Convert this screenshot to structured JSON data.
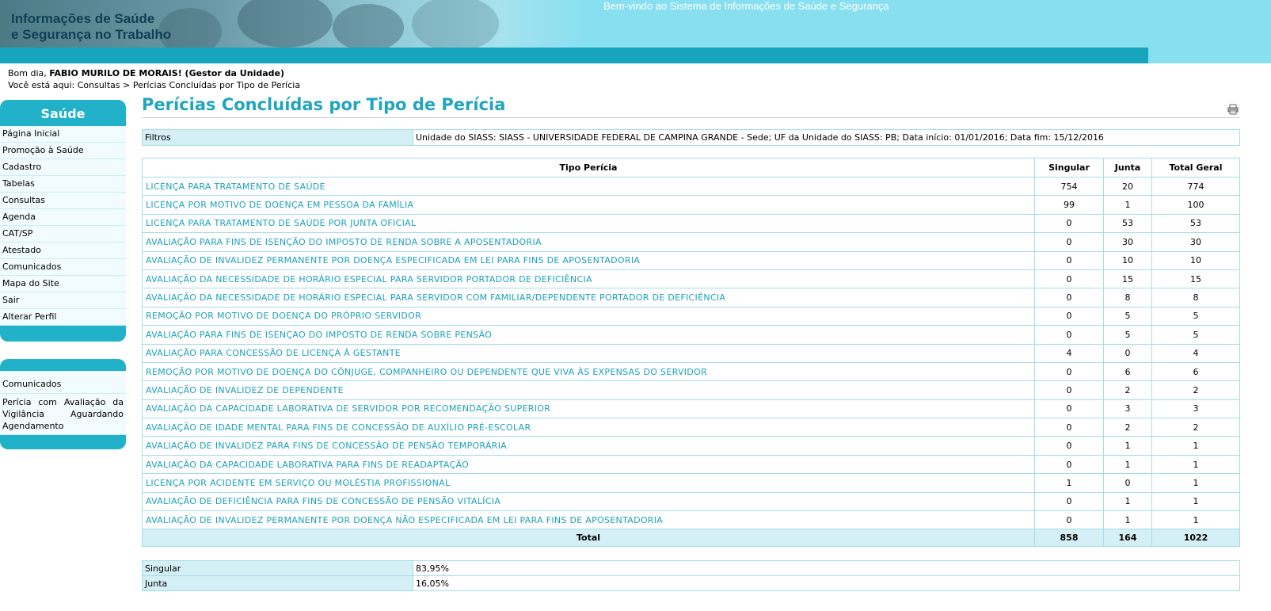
{
  "header": {
    "title_line1": "Informações de Saúde",
    "title_line2": "e Segurança no Trabalho",
    "welcome": "Bem-vindo ao Sistema de Informações de Saúde e Segurança"
  },
  "user": {
    "greeting_prefix": "Bom dia, ",
    "name": "FABIO MURILO DE MORAIS! (Gestor da Unidade)"
  },
  "breadcrumb": {
    "prefix": "Você está aqui: ",
    "parent": "Consultas",
    "separator": " > ",
    "current": "Perícias Concluídas por Tipo de Perícia"
  },
  "sidebar": {
    "title": "Saúde",
    "items": [
      {
        "label": "Página Inicial"
      },
      {
        "label": "Promoção à Saúde"
      },
      {
        "label": "Cadastro"
      },
      {
        "label": "Tabelas"
      },
      {
        "label": "Consultas"
      },
      {
        "label": "Agenda"
      },
      {
        "label": "CAT/SP"
      },
      {
        "label": "Atestado"
      },
      {
        "label": "Comunicados"
      },
      {
        "label": "Mapa do Site"
      },
      {
        "label": "Sair"
      },
      {
        "label": "Alterar Perfil"
      }
    ]
  },
  "sidebar2": {
    "items": [
      {
        "label": "Comunicados"
      },
      {
        "label": "Perícia com Avaliação da Vigilância Aguardando Agendamento"
      }
    ]
  },
  "page": {
    "title": "Perícias Concluídas por Tipo de Perícia",
    "print_icon": "printer-icon"
  },
  "filters": {
    "label": "Filtros",
    "value": "Unidade do SIASS: SIASS - UNIVERSIDADE FEDERAL DE CAMPINA GRANDE - Sede; UF da Unidade do SIASS: PB; Data início: 01/01/2016; Data fim: 15/12/2016"
  },
  "table": {
    "headers": {
      "tipo": "Tipo Perícia",
      "singular": "Singular",
      "junta": "Junta",
      "total": "Total Geral"
    },
    "rows": [
      {
        "tipo": "LICENÇA PARA TRATAMENTO DE SAÚDE",
        "singular": "754",
        "junta": "20",
        "total": "774"
      },
      {
        "tipo": "LICENÇA POR MOTIVO DE DOENÇA EM PESSOA DA FAMÍLIA",
        "singular": "99",
        "junta": "1",
        "total": "100"
      },
      {
        "tipo": "LICENÇA PARA TRATAMENTO DE SAÚDE POR JUNTA OFICIAL",
        "singular": "0",
        "junta": "53",
        "total": "53"
      },
      {
        "tipo": "AVALIAÇÃO PARA FINS DE ISENÇÃO DO IMPOSTO DE RENDA SOBRE A APOSENTADORIA",
        "singular": "0",
        "junta": "30",
        "total": "30"
      },
      {
        "tipo": "AVALIAÇÃO DE INVALIDEZ PERMANENTE POR DOENÇA ESPECIFICADA EM LEI PARA FINS DE APOSENTADORIA",
        "singular": "0",
        "junta": "10",
        "total": "10"
      },
      {
        "tipo": "AVALIAÇÃO DA NECESSIDADE DE HORÁRIO ESPECIAL PARA SERVIDOR PORTADOR DE DEFICIÊNCIA",
        "singular": "0",
        "junta": "15",
        "total": "15"
      },
      {
        "tipo": "AVALIAÇÃO DA NECESSIDADE DE HORÁRIO ESPECIAL PARA SERVIDOR COM FAMILIAR/DEPENDENTE PORTADOR DE DEFICIÊNCIA",
        "singular": "0",
        "junta": "8",
        "total": "8"
      },
      {
        "tipo": "REMOÇÃO POR MOTIVO DE DOENÇA DO PRÓPRIO SERVIDOR",
        "singular": "0",
        "junta": "5",
        "total": "5"
      },
      {
        "tipo": "AVALIAÇÃO PARA FINS DE ISENÇAO DO IMPOSTO DE RENDA SOBRE PENSÃO",
        "singular": "0",
        "junta": "5",
        "total": "5"
      },
      {
        "tipo": "AVALIAÇÃO PARA CONCESSÃO DE LICENÇA À GESTANTE",
        "singular": "4",
        "junta": "0",
        "total": "4"
      },
      {
        "tipo": "REMOÇÃO POR MOTIVO DE DOENÇA DO CÔNJUGE, COMPANHEIRO OU DEPENDENTE QUE VIVA ÀS EXPENSAS DO SERVIDOR",
        "singular": "0",
        "junta": "6",
        "total": "6"
      },
      {
        "tipo": "AVALIAÇÃO DE INVALIDEZ DE DEPENDENTE",
        "singular": "0",
        "junta": "2",
        "total": "2"
      },
      {
        "tipo": "AVALIAÇÃO DA CAPACIDADE LABORATIVA DE SERVIDOR POR RECOMENDAÇÃO SUPERIOR",
        "singular": "0",
        "junta": "3",
        "total": "3"
      },
      {
        "tipo": "AVALIAÇÃO DE IDADE MENTAL PARA FINS DE CONCESSÃO DE AUXÍLIO PRÉ-ESCOLAR",
        "singular": "0",
        "junta": "2",
        "total": "2"
      },
      {
        "tipo": "AVALIAÇÃO DE INVALIDEZ PARA FINS DE CONCESSÃO DE PENSÃO TEMPORÁRIA",
        "singular": "0",
        "junta": "1",
        "total": "1"
      },
      {
        "tipo": "AVALIAÇÃO DA CAPACIDADE LABORATIVA PARA FINS DE READAPTAÇÃO",
        "singular": "0",
        "junta": "1",
        "total": "1"
      },
      {
        "tipo": "LICENÇA POR ACIDENTE EM SERVIÇO OU MOLÉSTIA PROFISSIONAL",
        "singular": "1",
        "junta": "0",
        "total": "1"
      },
      {
        "tipo": "AVALIAÇÃO DE DEFICIÊNCIA PARA FINS DE CONCESSÃO DE PENSÃO VITALÍCIA",
        "singular": "0",
        "junta": "1",
        "total": "1"
      },
      {
        "tipo": "AVALIAÇÃO DE INVALIDEZ PERMANENTE POR DOENÇA NÃO ESPECIFICADA EM LEI PARA FINS DE APOSENTADORIA",
        "singular": "0",
        "junta": "1",
        "total": "1"
      }
    ],
    "total": {
      "label": "Total",
      "singular": "858",
      "junta": "164",
      "total": "1022"
    }
  },
  "percentages": [
    {
      "label": "Singular",
      "value": "83,95%"
    },
    {
      "label": "Junta",
      "value": "16,05%"
    }
  ],
  "colors": {
    "accent": "#21b1c8",
    "link": "#1aa1bb",
    "title": "#21a5be",
    "light_cell": "#d4eff5"
  }
}
